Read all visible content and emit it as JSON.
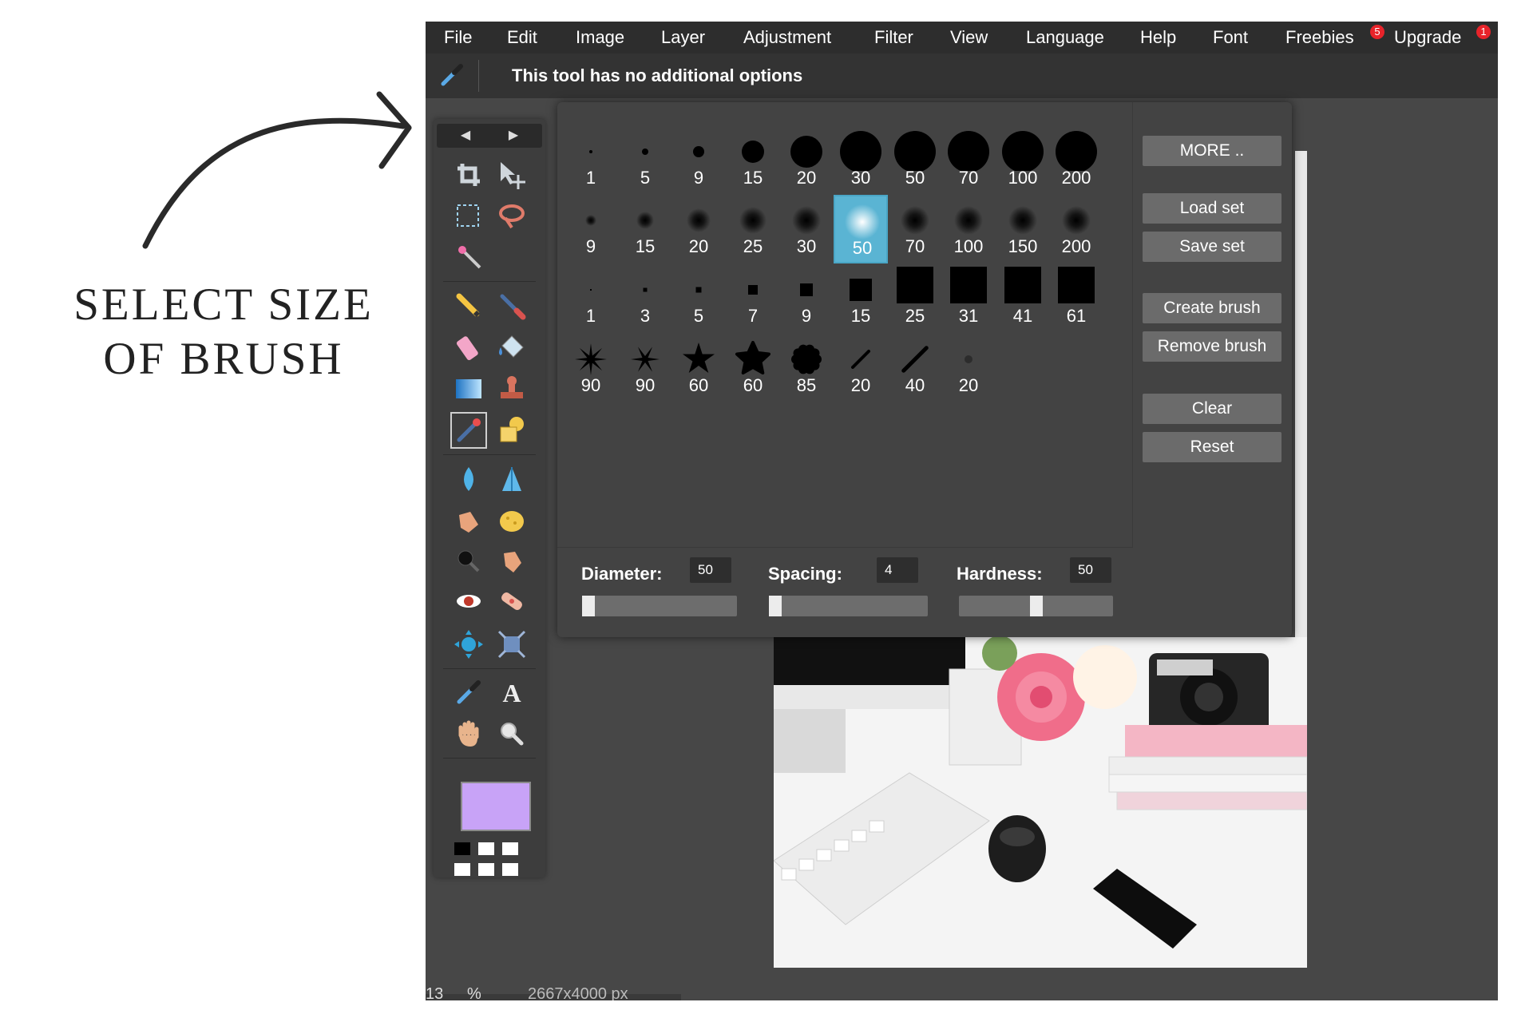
{
  "annotation": {
    "line1": "SELECT SIZE",
    "line2": "OF BRUSH"
  },
  "menu": {
    "items": [
      "File",
      "Edit",
      "Image",
      "Layer",
      "Adjustment",
      "Filter",
      "View",
      "Language",
      "Help",
      "Font",
      "Freebies",
      "Upgrade"
    ],
    "freebies_badge": "5",
    "upgrade_badge": "1"
  },
  "options_bar": {
    "text": "This tool has no additional options"
  },
  "brush_rows": [
    {
      "style": "hard-circle",
      "sizes": [
        "1",
        "5",
        "9",
        "15",
        "20",
        "30",
        "50",
        "70",
        "100",
        "200"
      ]
    },
    {
      "style": "soft-circle",
      "sizes": [
        "9",
        "15",
        "20",
        "25",
        "30",
        "50",
        "70",
        "100",
        "150",
        "200"
      ]
    },
    {
      "style": "square",
      "sizes": [
        "1",
        "3",
        "5",
        "7",
        "9",
        "15",
        "25",
        "31",
        "41",
        "61"
      ]
    },
    {
      "style": "special",
      "sizes": [
        "90",
        "90",
        "60",
        "60",
        "85",
        "20",
        "40",
        "20"
      ]
    }
  ],
  "selected_brush": {
    "row": 1,
    "index": 5
  },
  "side_buttons": [
    "MORE ..",
    "Load set",
    "Save set",
    "Create brush",
    "Remove brush",
    "Clear",
    "Reset"
  ],
  "sliders": {
    "diameter": {
      "label": "Diameter:",
      "value": "50",
      "fraction": 0.0
    },
    "spacing": {
      "label": "Spacing:",
      "value": "4",
      "fraction": 0.0
    },
    "hardness": {
      "label": "Hardness:",
      "value": "50",
      "fraction": 0.5
    }
  },
  "colors": {
    "primary": "#c8a3f7",
    "selected_highlight": "#5ab4d3",
    "badge": "#e8232a"
  },
  "status": {
    "zoom": "13",
    "zoom_unit": "%",
    "dimensions": "2667x4000 px"
  },
  "tools": [
    "crop-icon",
    "move-icon",
    "marquee-icon",
    "lasso-icon",
    "magic-wand-icon",
    "pencil-icon",
    "brush-icon",
    "eraser-icon",
    "paint-bucket-icon",
    "gradient-icon",
    "clone-stamp-icon",
    "color-replace-icon",
    "shape-icon",
    "blur-icon",
    "sharpen-icon",
    "smudge-icon",
    "sponge-icon",
    "dodge-icon",
    "burn-icon",
    "red-eye-icon",
    "spot-heal-icon",
    "bloat-icon",
    "pinch-icon",
    "color-picker-icon",
    "type-icon",
    "hand-icon",
    "zoom-icon"
  ]
}
